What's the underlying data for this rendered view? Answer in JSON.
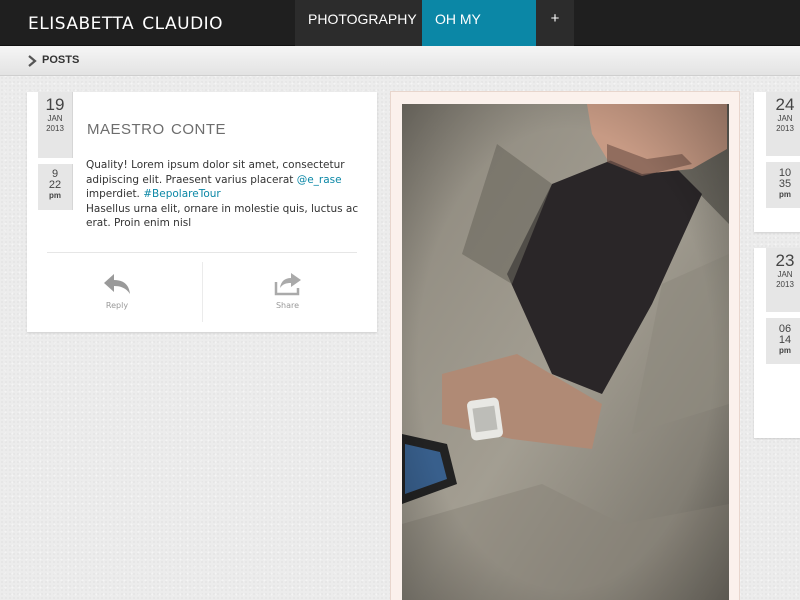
{
  "header": {
    "brand": "elisabetta claudio",
    "nav": [
      {
        "label": "PHOTOGRAPHY"
      },
      {
        "label": "OH MY BLOG!"
      },
      {
        "label": "+"
      }
    ]
  },
  "breadcrumb": {
    "label": "POSTS"
  },
  "post": {
    "date": {
      "day": "19",
      "month": "Jan",
      "year": "2013"
    },
    "time": {
      "hour": "9",
      "minute": "22",
      "ampm": "pm"
    },
    "title": "maestro conte",
    "body_1": "Quality! Lorem ipsum dolor sit amet, consectetur adipiscing elit. Praesent varius placerat ",
    "mention": "@e_rase",
    "body_2": " imperdiet. ",
    "hashtag": "#BepolareTour",
    "body_3": "Hasellus urna elit, ornare in molestie quis, luctus ac erat. Proin enim nisl",
    "actions": {
      "reply": "Reply",
      "share": "Share"
    }
  },
  "side_posts": [
    {
      "day": "24",
      "month": "Jan",
      "year": "2013",
      "hour": "10",
      "minute": "35",
      "ampm": "pm"
    },
    {
      "day": "23",
      "month": "Jan",
      "year": "2013",
      "hour": "06",
      "minute": "14",
      "ampm": "pm"
    }
  ],
  "colors": {
    "accent": "#0b87a6",
    "topbar": "#1f1f1f"
  }
}
